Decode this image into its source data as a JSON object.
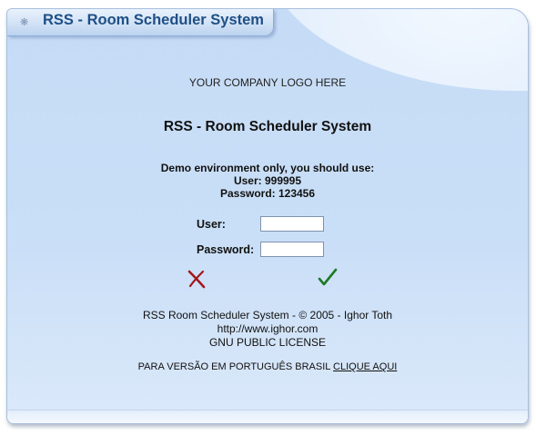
{
  "panel": {
    "title": "RSS - Room Scheduler System"
  },
  "main": {
    "logo_placeholder": "YOUR COMPANY LOGO HERE",
    "heading": "RSS - Room Scheduler System",
    "demo_notice": {
      "line1": "Demo environment only, you should use:",
      "line2": "User: 999995",
      "line3": "Password: 123456"
    }
  },
  "login_form": {
    "user_label": "User:",
    "user_value": "",
    "password_label": "Password:",
    "password_value": "",
    "cancel_icon": "x-cross-icon",
    "submit_icon": "checkmark-icon"
  },
  "footer": {
    "copyright": "RSS Room Scheduler System - © 2005 - Ighor Toth",
    "website": "http://www.ighor.com",
    "license": "GNU PUBLIC LICENSE",
    "portuguese_prefix": "PARA VERSÃO EM PORTUGUÊS BRASIL",
    "portuguese_link": "CLIQUE AQUI"
  },
  "colors": {
    "panel_bg": "#c6dcf6",
    "title_text": "#1f4f86",
    "cancel_red": "#a3171c",
    "submit_green": "#1d7a23"
  }
}
